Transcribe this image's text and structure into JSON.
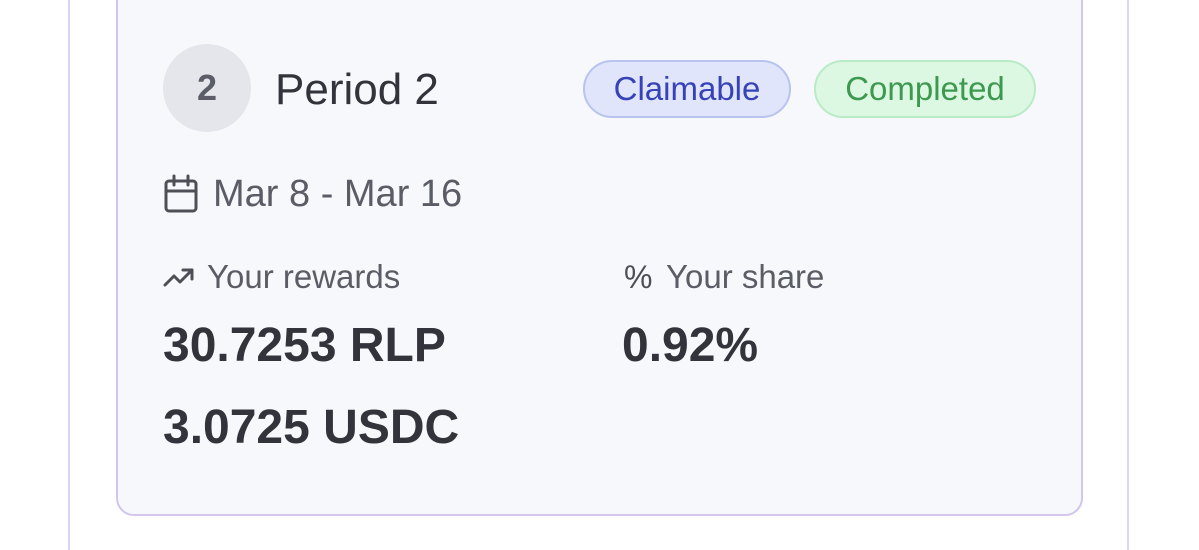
{
  "period": {
    "number": "2",
    "title": "Period 2",
    "date_range": "Mar 8 - Mar 16",
    "badges": {
      "claimable": "Claimable",
      "completed": "Completed"
    },
    "rewards": {
      "label": "Your rewards",
      "icon": "trending-up-icon",
      "values": [
        "30.7253 RLP",
        "3.0725 USDC"
      ]
    },
    "share": {
      "label": "Your share",
      "icon": "percent-icon",
      "icon_glyph": "%",
      "value": "0.92%"
    }
  },
  "colors": {
    "card_background": "#f7f8fc",
    "card_border": "#d2c6ef",
    "claimable_bg": "#e0e5fb",
    "claimable_text": "#3742b8",
    "completed_bg": "#dcf7e2",
    "completed_text": "#3d9950",
    "primary_text": "#33343b"
  }
}
